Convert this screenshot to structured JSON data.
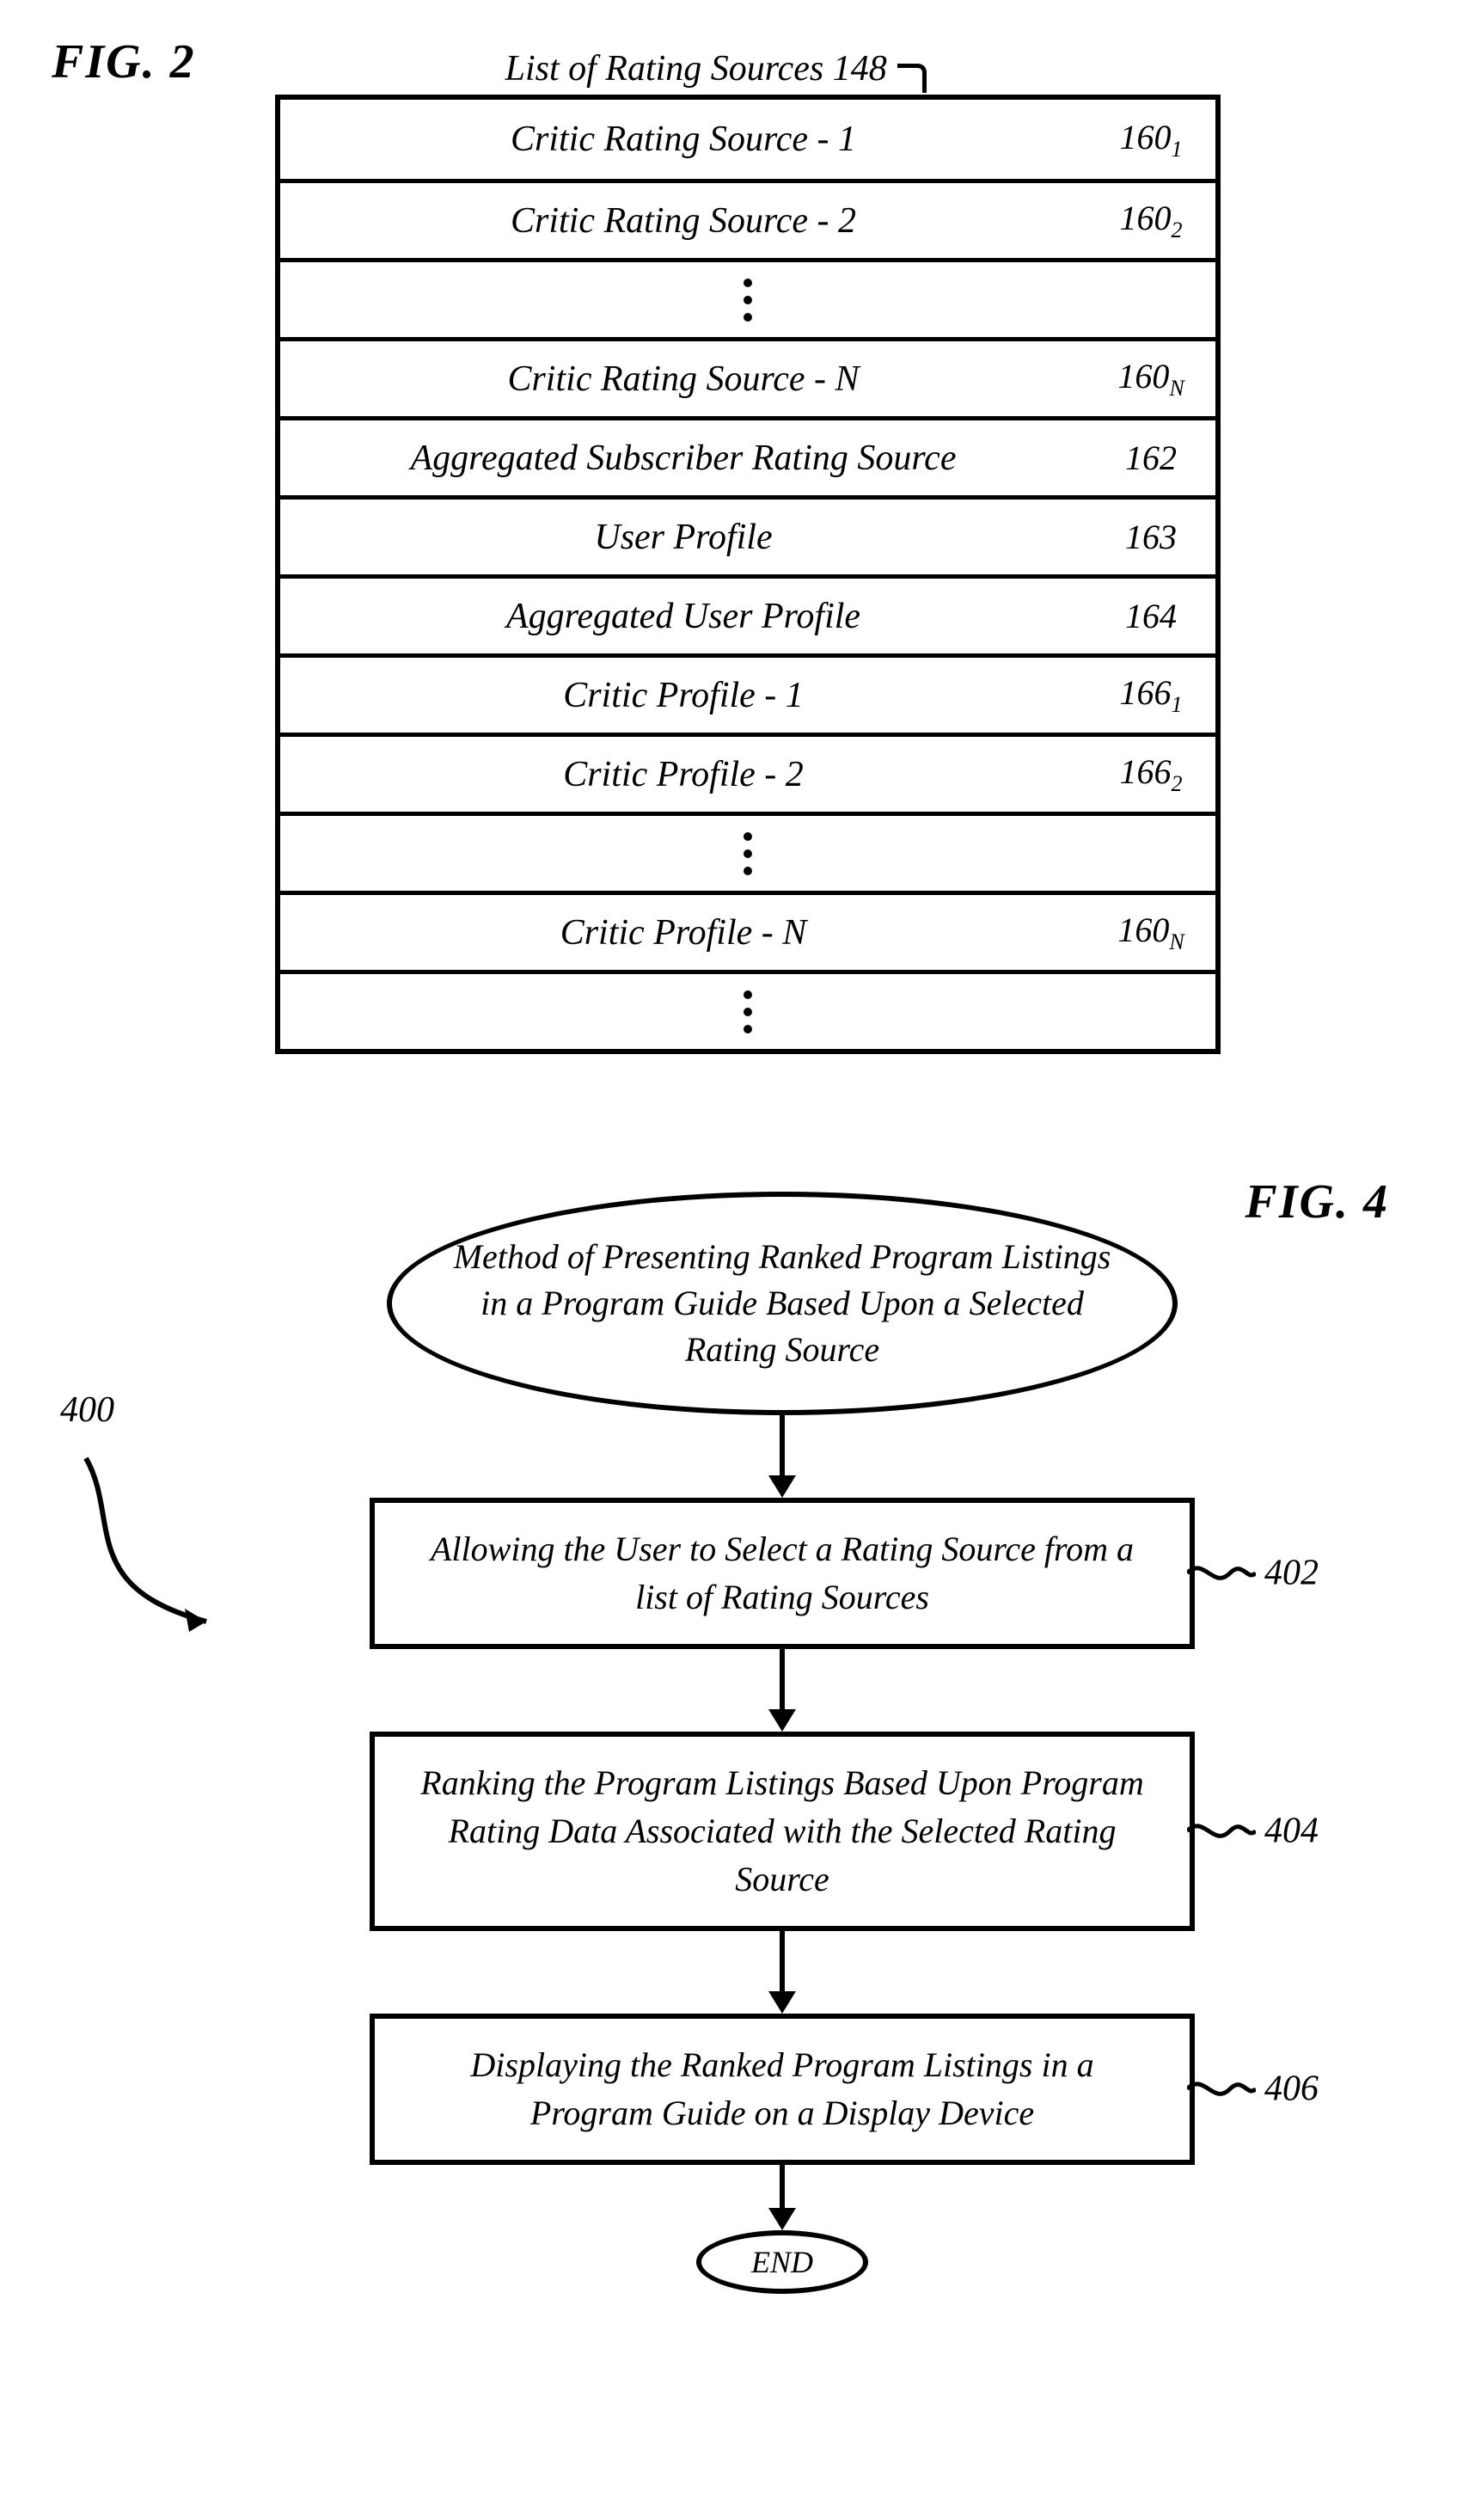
{
  "fig2": {
    "label": "FIG. 2",
    "list_title": "List of Rating Sources 148",
    "rows": [
      {
        "label": "Critic Rating Source - 1",
        "ref": "160",
        "sub": "1"
      },
      {
        "label": "Critic Rating Source - 2",
        "ref": "160",
        "sub": "2"
      },
      {
        "vdots": true
      },
      {
        "label": "Critic Rating Source - N",
        "ref": "160",
        "sub": "N"
      },
      {
        "label": "Aggregated Subscriber Rating Source",
        "ref": "162",
        "sub": ""
      },
      {
        "label": "User Profile",
        "ref": "163",
        "sub": ""
      },
      {
        "label": "Aggregated User Profile",
        "ref": "164",
        "sub": ""
      },
      {
        "label": "Critic Profile - 1",
        "ref": "166",
        "sub": "1"
      },
      {
        "label": "Critic Profile - 2",
        "ref": "166",
        "sub": "2"
      },
      {
        "vdots": true
      },
      {
        "label": "Critic Profile - N",
        "ref": "160",
        "sub": "N"
      },
      {
        "vdots": true
      }
    ]
  },
  "fig4": {
    "label": "FIG. 4",
    "ref400": "400",
    "start": "Method of Presenting Ranked Program Listings in a Program Guide Based Upon a Selected Rating Source",
    "steps": [
      {
        "text": "Allowing the User to Select a Rating Source from a list of Rating Sources",
        "ref": "402"
      },
      {
        "text": "Ranking the Program Listings Based Upon Program Rating Data Associated with the Selected Rating Source",
        "ref": "404"
      },
      {
        "text": "Displaying the Ranked Program Listings in a Program Guide on a Display Device",
        "ref": "406"
      }
    ],
    "end": "END"
  }
}
